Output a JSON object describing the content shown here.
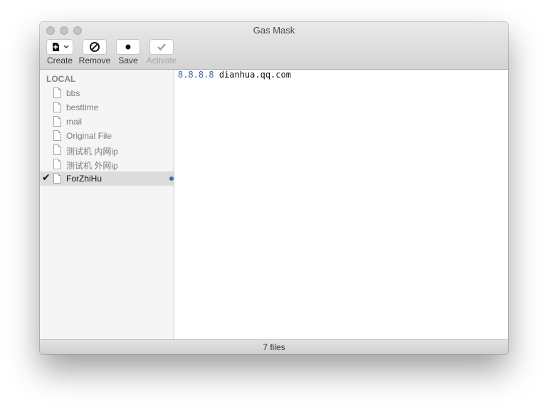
{
  "window": {
    "title": "Gas Mask"
  },
  "toolbar": {
    "create_label": "Create",
    "remove_label": "Remove",
    "save_label": "Save",
    "activate_label": "Activate"
  },
  "sidebar": {
    "section_header": "LOCAL",
    "items": [
      {
        "label": "bbs",
        "icon": "file-icon",
        "active": false
      },
      {
        "label": "besttime",
        "icon": "file-icon",
        "active": false
      },
      {
        "label": "mail",
        "icon": "file-icon",
        "active": false
      },
      {
        "label": "Original File",
        "icon": "file-icon",
        "active": false
      },
      {
        "label": "测试机 内网ip",
        "icon": "file-icon",
        "active": false
      },
      {
        "label": "测试机 外网ip",
        "icon": "file-icon",
        "active": false
      },
      {
        "label": "ForZhiHu",
        "icon": "file-icon",
        "active": true,
        "unsaved": true
      }
    ]
  },
  "editor": {
    "lines": [
      {
        "ip": "8.8.8.8",
        "host": "dianhua.qq.com"
      }
    ]
  },
  "status": {
    "text": "7 files"
  },
  "colors": {
    "ip_text": "#3c66a6",
    "unsaved_dot": "#3b6fb8",
    "selection": "#dcdcdc"
  }
}
